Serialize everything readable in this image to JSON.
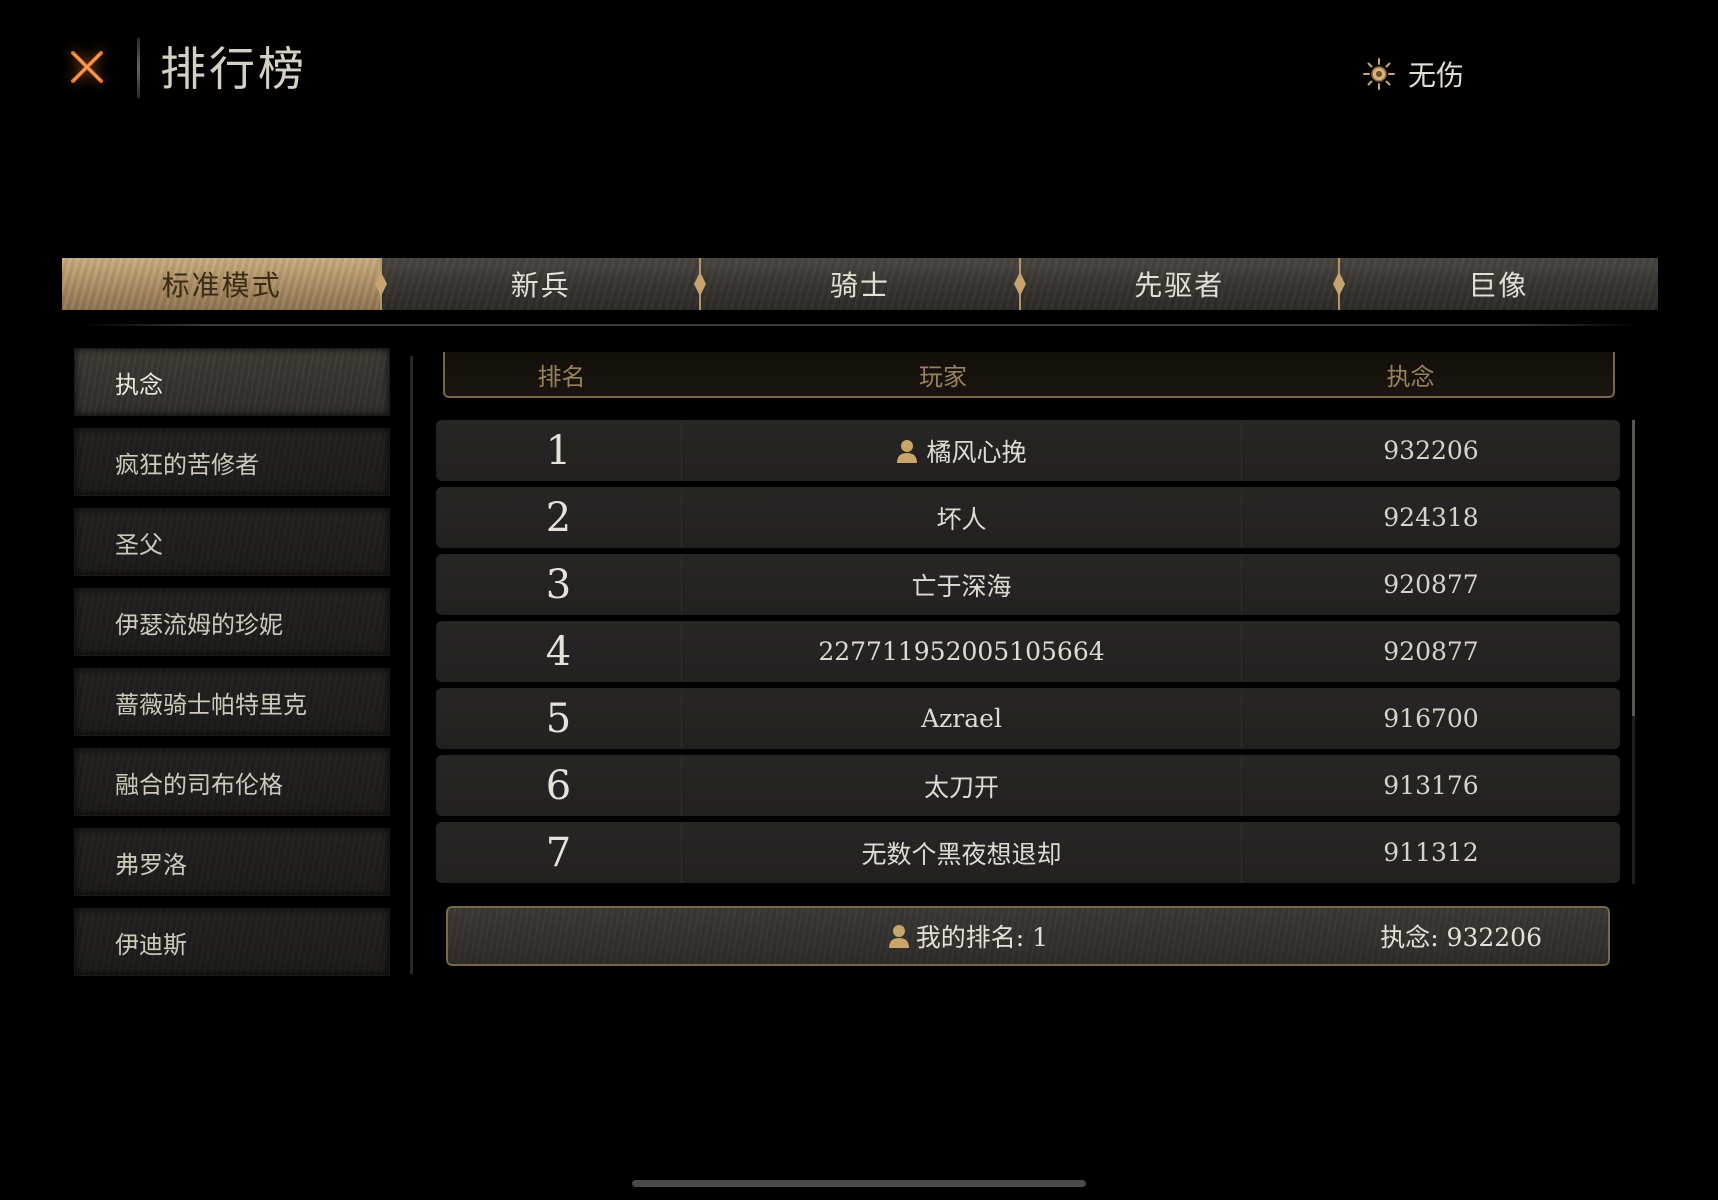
{
  "header": {
    "title": "排行榜",
    "mode_label": "无伤"
  },
  "tabs": [
    {
      "label": "标准模式",
      "active": true
    },
    {
      "label": "新兵",
      "active": false
    },
    {
      "label": "骑士",
      "active": false
    },
    {
      "label": "先驱者",
      "active": false
    },
    {
      "label": "巨像",
      "active": false
    }
  ],
  "bosses": [
    {
      "label": "执念",
      "active": true
    },
    {
      "label": "疯狂的苦修者",
      "active": false
    },
    {
      "label": "圣父",
      "active": false
    },
    {
      "label": "伊瑟流姆的珍妮",
      "active": false
    },
    {
      "label": "蔷薇骑士帕特里克",
      "active": false
    },
    {
      "label": "融合的司布伦格",
      "active": false
    },
    {
      "label": "弗罗洛",
      "active": false
    },
    {
      "label": "伊迪斯",
      "active": false
    }
  ],
  "table": {
    "headers": {
      "rank": "排名",
      "player": "玩家",
      "score": "执念"
    },
    "rows": [
      {
        "rank": "1",
        "player": "橘风心挽",
        "score": "932206",
        "is_me": true
      },
      {
        "rank": "2",
        "player": "坏人",
        "score": "924318",
        "is_me": false
      },
      {
        "rank": "3",
        "player": "亡于深海",
        "score": "920877",
        "is_me": false
      },
      {
        "rank": "4",
        "player": "227711952005105664",
        "score": "920877",
        "is_me": false
      },
      {
        "rank": "5",
        "player": "Azrael",
        "score": "916700",
        "is_me": false
      },
      {
        "rank": "6",
        "player": "太刀开",
        "score": "913176",
        "is_me": false
      },
      {
        "rank": "7",
        "player": "无数个黑夜想退却",
        "score": "911312",
        "is_me": false
      }
    ]
  },
  "my_rank": {
    "rank_text": "我的排名: 1",
    "score_text": "执念: 932206"
  },
  "colors": {
    "accent_gold": "#a98b60",
    "border_gold": "#7a6547",
    "background": "#000000",
    "close_icon": "#e2772a"
  },
  "icons": {
    "close": "close-x-icon",
    "mode": "sun-icon",
    "user": "user-icon"
  }
}
